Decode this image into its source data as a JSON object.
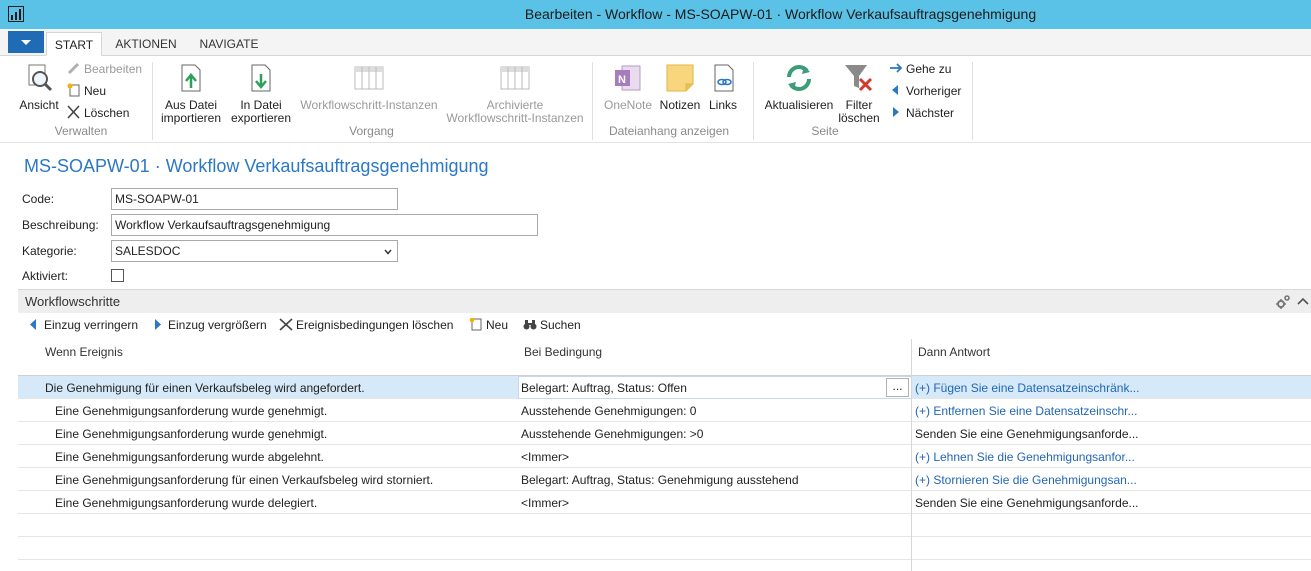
{
  "window": {
    "title": "Bearbeiten - Workflow - MS-SOAPW-01 · Workflow Verkaufsauftragsgenehmigung"
  },
  "tabs": [
    {
      "label": "START",
      "active": true
    },
    {
      "label": "AKTIONEN",
      "active": false
    },
    {
      "label": "NAVIGATE",
      "active": false
    }
  ],
  "ribbon": {
    "verwalten": {
      "label": "Verwalten",
      "ansicht": "Ansicht",
      "bearbeiten": "Bearbeiten",
      "neu": "Neu",
      "loeschen": "Löschen"
    },
    "vorgang": {
      "label": "Vorgang",
      "import_line1": "Aus Datei",
      "import_line2": "importieren",
      "export_line1": "In Datei",
      "export_line2": "exportieren",
      "steps": "Workflowschritt-Instanzen",
      "archived_line1": "Archivierte",
      "archived_line2": "Workflowschritt-Instanzen"
    },
    "dateianhang": {
      "label": "Dateianhang anzeigen",
      "onenote": "OneNote",
      "notizen": "Notizen",
      "links": "Links"
    },
    "seite": {
      "label": "Seite",
      "aktualisieren": "Aktualisieren",
      "filter_line1": "Filter",
      "filter_line2": "löschen",
      "gehe_zu": "Gehe zu",
      "vorheriger": "Vorheriger",
      "naechster": "Nächster"
    }
  },
  "page": {
    "title": "MS-SOAPW-01 · Workflow Verkaufsauftragsgenehmigung"
  },
  "form": {
    "code_label": "Code:",
    "code_value": "MS-SOAPW-01",
    "beschreibung_label": "Beschreibung:",
    "beschreibung_value": "Workflow Verkaufsauftragsgenehmigung",
    "kategorie_label": "Kategorie:",
    "kategorie_value": "SALESDOC",
    "aktiviert_label": "Aktiviert:",
    "aktiviert": false
  },
  "part": {
    "title": "Workflowschritte",
    "tools": {
      "decrease_indent": "Einzug verringern",
      "increase_indent": "Einzug vergrößern",
      "clear_conditions": "Ereignisbedingungen löschen",
      "new": "Neu",
      "search": "Suchen"
    },
    "columns": {
      "event": "Wenn Ereignis",
      "condition": "Bei Bedingung",
      "response": "Dann Antwort"
    },
    "rows": [
      {
        "event": "Die Genehmigung für einen Verkaufsbeleg wird angefordert.",
        "condition": "Belegart: Auftrag, Status: Offen",
        "response": "(+) Fügen Sie eine Datensatzeinschränk...",
        "response_link": true,
        "indent": 0,
        "selected": true
      },
      {
        "event": "Eine Genehmigungsanforderung wurde genehmigt.",
        "condition": "Ausstehende Genehmigungen: 0",
        "response": "(+) Entfernen Sie eine Datensatzeinschr...",
        "response_link": true,
        "indent": 1,
        "selected": false
      },
      {
        "event": "Eine Genehmigungsanforderung wurde genehmigt.",
        "condition": "Ausstehende Genehmigungen: >0",
        "response": "Senden Sie eine Genehmigungsanforde...",
        "response_link": false,
        "indent": 1,
        "selected": false
      },
      {
        "event": "Eine Genehmigungsanforderung wurde abgelehnt.",
        "condition": "<Immer>",
        "response": "(+) Lehnen Sie die Genehmigungsanfor...",
        "response_link": true,
        "indent": 1,
        "selected": false
      },
      {
        "event": "Eine Genehmigungsanforderung für einen Verkaufsbeleg wird storniert.",
        "condition": "Belegart: Auftrag, Status: Genehmigung ausstehend",
        "response": "(+) Stornieren Sie die Genehmigungsan...",
        "response_link": true,
        "indent": 1,
        "selected": false
      },
      {
        "event": "Eine Genehmigungsanforderung wurde delegiert.",
        "condition": "<Immer>",
        "response": "Senden Sie eine Genehmigungsanforde...",
        "response_link": false,
        "indent": 1,
        "selected": false
      }
    ],
    "ellipsis": "..."
  }
}
